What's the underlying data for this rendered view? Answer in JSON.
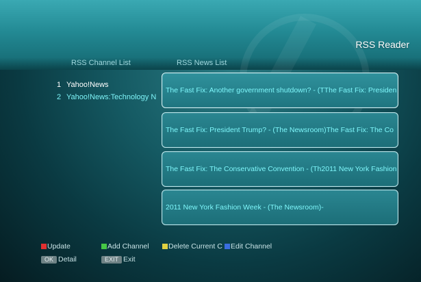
{
  "header": {
    "title": "RSS Reader"
  },
  "channel_list": {
    "heading": "RSS Channel List",
    "items": [
      {
        "num": "1",
        "name": "Yahoo!News"
      },
      {
        "num": "2",
        "name": "Yahoo!News:Technology N"
      }
    ]
  },
  "news_list": {
    "heading": "RSS News List",
    "items": [
      "The Fast Fix: Another government shutdown? -    (TThe Fast Fix: Presiden",
      "The Fast Fix: President Trump? -    (The Newsroom)The Fast Fix: The Co",
      "The Fast Fix: The Conservative Convention -    (Th2011 New York Fashion",
      "2011 New York Fashion Week -    (The Newsroom)-"
    ]
  },
  "legend": {
    "update": "Update",
    "add_channel": "Add Channel",
    "delete_current": "Delete Current C",
    "edit_channel": "Edit Channel",
    "ok_key": "OK",
    "ok_label": "Detail",
    "exit_key": "EXIT",
    "exit_label": "Exit"
  },
  "colors": {
    "red": "#e03030",
    "green": "#46c846",
    "yellow": "#e0d040",
    "blue": "#3a6ee0"
  }
}
